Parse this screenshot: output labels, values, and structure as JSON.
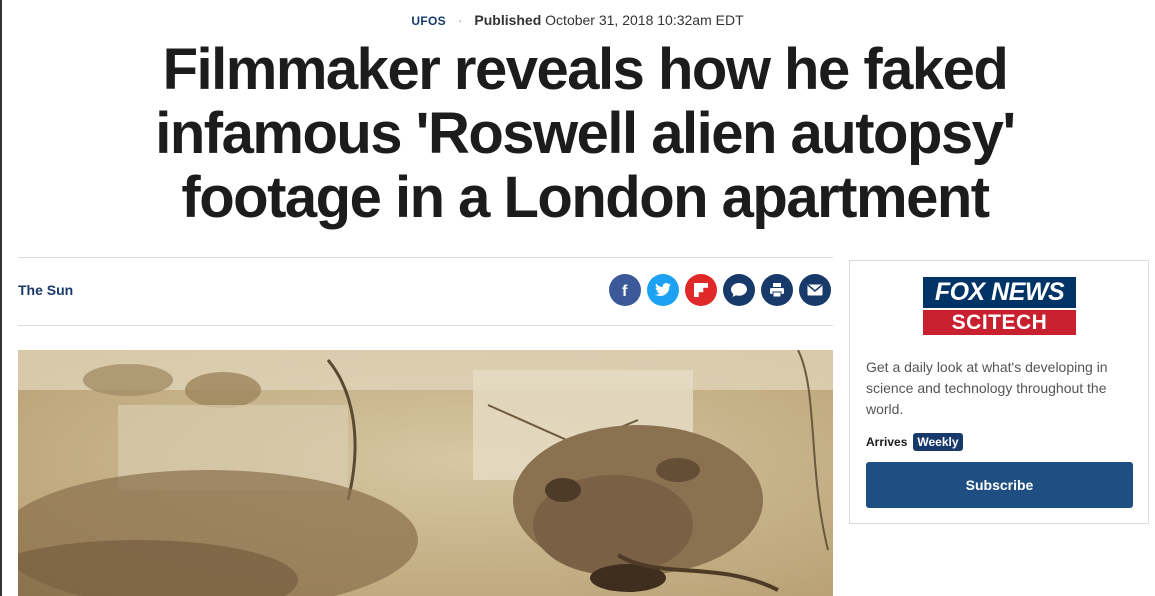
{
  "article": {
    "category": "UFOS",
    "separator": "·",
    "published_label": "Published",
    "published_date": "October 31, 2018 10:32am EDT",
    "headline": "Filmmaker reveals how he faked infamous 'Roswell alien autopsy' footage in a London apartment",
    "source": "The Sun"
  },
  "share": {
    "icons": [
      "facebook-icon",
      "twitter-icon",
      "flipboard-icon",
      "comments-icon",
      "print-icon",
      "email-icon"
    ],
    "colors": {
      "facebook": "#3b5998",
      "twitter": "#1da1f2",
      "flipboard": "#e12828",
      "navy": "#183a6b"
    }
  },
  "newsletter": {
    "logo_top": "FOX NEWS",
    "logo_bottom": "SCITECH",
    "description": "Get a daily look at what's developing in science and technology throughout the world.",
    "arrives_label": "Arrives",
    "frequency": "Weekly",
    "subscribe_label": "Subscribe"
  },
  "colors": {
    "brand_navy": "#183a6b",
    "button_blue": "#1f4e82",
    "fox_red": "#c8202f"
  }
}
